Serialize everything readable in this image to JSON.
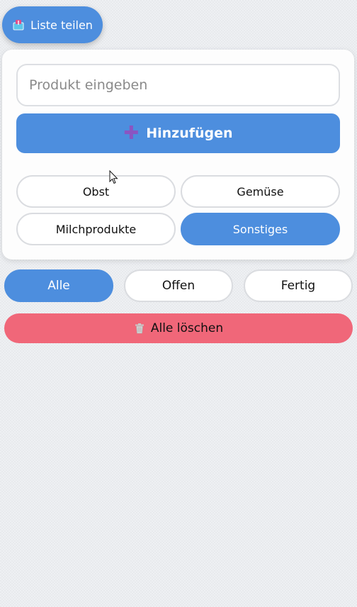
{
  "share": {
    "label": "Liste teilen",
    "icon": "share-box-icon"
  },
  "form": {
    "placeholder": "Produkt eingeben",
    "value": "",
    "add_label": "Hinzufügen",
    "add_icon": "plus-icon"
  },
  "categories": [
    {
      "label": "Obst",
      "active": false
    },
    {
      "label": "Gemüse",
      "active": false
    },
    {
      "label": "Milchprodukte",
      "active": false
    },
    {
      "label": "Sonstiges",
      "active": true
    }
  ],
  "filters": [
    {
      "label": "Alle",
      "active": true
    },
    {
      "label": "Offen",
      "active": false
    },
    {
      "label": "Fertig",
      "active": false
    }
  ],
  "clear": {
    "label": "Alle löschen",
    "icon": "trash-icon"
  },
  "colors": {
    "accent": "#4d8ede",
    "danger": "#f06779",
    "plus": "#8a55c2"
  }
}
